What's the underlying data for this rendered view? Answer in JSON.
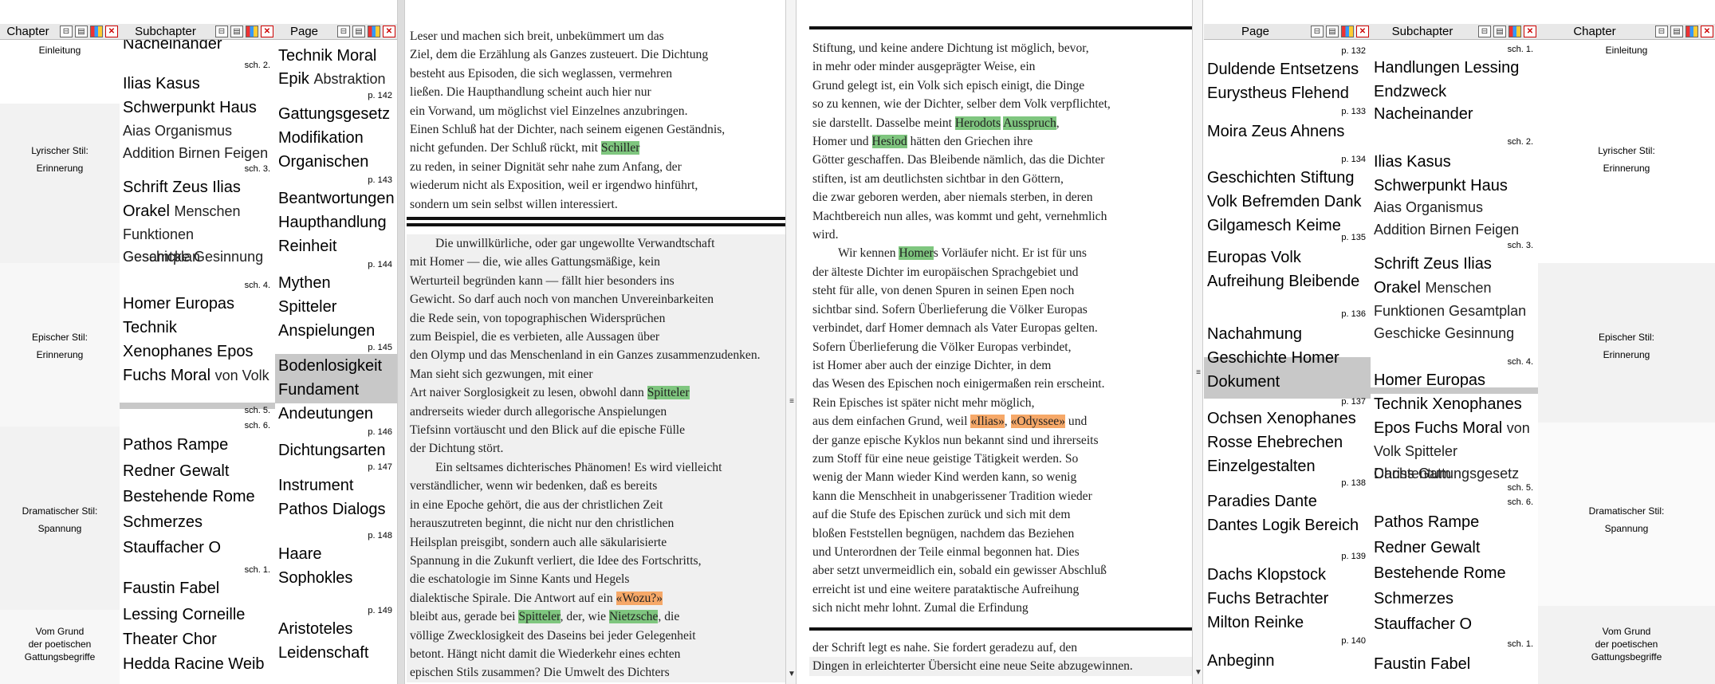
{
  "left": {
    "chapter": {
      "title": "Chapter",
      "items": [
        "Einleitung",
        "Lyrischer Stil:",
        "Erinnerung",
        "Epischer Stil:",
        "Erinnerung",
        "Dramatischer Stil:",
        "Spannung",
        "Vom Grund",
        "der poetischen",
        "Gattungsbegriffe"
      ]
    },
    "subchapter": {
      "title": "Subchapter",
      "lines": [
        "Nacheinander",
        "sch. 2.",
        "Ilias Kasus",
        "Schwerpunkt Haus",
        "Aias Organismus",
        "Addition Birnen Feigen",
        "sch. 3.",
        "Schrift Zeus Ilias",
        "Orakel",
        "Menschen",
        "Funktionen Gesamtplan",
        "Geschicke Gesinnung",
        "sch. 4.",
        "Homer Europas",
        "Technik",
        "Xenophanes Epos",
        "Fuchs Moral",
        "von Volk",
        "sch. 5.",
        "sch. 6.",
        "Pathos Rampe",
        "Redner Gewalt",
        "Bestehende Rome",
        "Schmerzes",
        "Stauffacher O",
        "sch. 1.",
        "Faustin Fabel",
        "Lessing Corneille",
        "Theater Chor",
        "Hedda Racine Weib"
      ]
    },
    "page": {
      "title": "Page",
      "lines": [
        "Technik Moral",
        "Epik",
        "Abstraktion",
        "p. 142",
        "Gattungsgesetz",
        "Modifikation",
        "Organischen",
        "p. 143",
        "Beantwortungen",
        "Haupthandlung",
        "Reinheit",
        "p. 144",
        "Mythen",
        "Spitteler",
        "Anspielungen",
        "p. 145",
        "Bodenlosigkeit",
        "Fundament",
        "Andeutungen",
        "p. 146",
        "Dichtungsarten",
        "p. 147",
        "Instrument",
        "Pathos Dialogs",
        "p. 148",
        "Haare",
        "Sophokles",
        "p. 149",
        "Aristoteles",
        "Leidenschaft"
      ]
    }
  },
  "text_left_top": [
    "Leser und machen sich breit, unbekümmert um das",
    "Ziel, dem die Erzählung als Ganzes zusteuert. Die Dichtung",
    "besteht aus Episoden, die sich weglassen, vermehren",
    "ließen. Die Haupthandlung scheint auch hier nur",
    "ein Vorwand, um möglichst viel Einzelnes anzubringen.",
    "Einen Schluß hat der Dichter, nach seinem eigenen Geständnis,",
    "nicht gefunden. Der Schluß rückt, mit ",
    "Schiller",
    "zu reden, in seiner Dignität sehr nahe zum Anfang, der",
    "wiederum nicht als Exposition, weil er irgendwo hinführt,",
    "sondern um sein selbst willen interessiert."
  ],
  "text_left_bottom": [
    "Die unwillkürliche, oder gar ungewollte Verwandtschaft",
    "mit Homer — die, wie alles Gattungsmäßige, kein",
    "Werturteil begründen kann — fällt hier besonders ins",
    "Gewicht. So darf auch noch von manchen Unvereinbarkeiten",
    "die Rede sein, von topographischen Widersprüchen",
    "zum Beispiel, die es verbieten, alle Aussagen über",
    "den Olymp und das Menschenland in ein Ganzes zusammenzudenken.",
    "Man sieht sich gezwungen, mit einer",
    "Art naiver Sorglosigkeit zu lesen, obwohl dann ",
    "Spitteler",
    "andrerseits wieder durch allegorische Anspielungen",
    "Tiefsinn vortäuscht und den Blick auf die epische Fülle",
    "der Dichtung stört.",
    "Ein seltsames dichterisches Phänomen! Es wird vielleicht",
    "verständlicher, wenn wir bedenken, daß es bereits",
    "in eine Epoche gehört, die aus der christlichen Zeit",
    "herauszutreten beginnt, die nicht nur den christlichen",
    "Heilsplan preisgibt, sondern auch alle säkularisierte",
    "Spannung in die Zukunft verliert, die Idee des Fortschritts,",
    "die eschatologie im Sinne Kants und Hegels",
    "dialektische Spirale. Die Antwort auf ein ",
    "«Wozu?»",
    "bleibt aus, gerade bei ",
    "Spitteler",
    ", der, wie ",
    "Nietzsche",
    ", die",
    "völlige Zwecklosigkeit des Daseins bei jeder Gelegenheit",
    "betont. Hängt nicht damit die Wiederkehr eines echten",
    "epischen Stils zusammen? Die Umwelt des Dichters"
  ],
  "text_right_top": [
    "Stiftung, und keine andere Dichtung ist möglich, bevor,",
    "in mehr oder minder ausgeprägter Weise, ein",
    "Grund gelegt ist, ein Volk sich episch einigt, die Dinge",
    "so zu kennen, wie der Dichter, selber dem Volk verpflichtet,",
    "sie darstellt. Dasselbe meint ",
    "Herodots",
    "Ausspruch",
    ",",
    "Homer und ",
    "Hesiod",
    " hätten den Griechen ihre",
    "Götter geschaffen. Das Bleibende nämlich, das die Dichter",
    "stiften, ist am deutlichsten sichtbar in den Göttern,",
    "die zwar geboren werden, aber niemals sterben, in deren",
    "Machtbereich nun alles, was kommt und geht, vernehmlich",
    "wird.",
    "Wir kennen ",
    "Homer",
    "s Vorläufer nicht. Er ist für uns",
    "der älteste Dichter im europäischen Sprachgebiet und",
    "steht für alle, von denen Spuren in seinen Epen noch",
    "sichtbar sind. Sofern Überlieferung die Völker Europas",
    "verbindet, darf Homer demnach als Vater Europas gelten.",
    "Sofern Überlieferung die Völker Europas verbindet,",
    "ist Homer aber auch der einzige Dichter, in dem",
    "das Wesen des Epischen noch einigermaßen rein erscheint.",
    "Rein Episches ist später nicht mehr möglich,",
    "aus dem einfachen Grund, weil ",
    "«Ilias»",
    "«Odyssee»",
    " und",
    "der ganze epische Kyklos nun bekannt sind und ihrerseits",
    "zum Stoff für eine neue geistige Tätigkeit werden. So",
    "wenig der Mann wieder Kind werden kann, so wenig",
    "kann die Menschheit in unabgerissener Tradition wieder",
    "auf die Stufe des Epischen zurück und sich mit dem",
    "bloßen Feststellen begnügen, nachdem das Beziehen",
    "und Unterordnen der Teile einmal begonnen hat. Dies",
    "aber setzt unvermeidlich ein, sobald ein gewisser Abschluß",
    "erreicht ist und eine weitere parataktische Aufreihung",
    "sich nicht mehr lohnt. Zumal die Erfindung"
  ],
  "text_right_bottom": [
    "der Schrift legt es nahe. Sie fordert geradezu auf, den",
    "Dingen in erleichterter Übersicht eine neue Seite abzugewinnen."
  ],
  "right": {
    "page": {
      "title": "Page",
      "lines": [
        "p. 132",
        "Duldende Entsetzens",
        "Eurystheus Flehend",
        "p. 133",
        "Moira Zeus Ahnens",
        "p. 134",
        "Geschichten Stiftung",
        "Volk Befremden Dank",
        "Gilgamesch Keime",
        "p. 135",
        "Europas Volk",
        "Aufreihung Bleibende",
        "p. 136",
        "Nachahmung",
        "Geschichte Homer",
        "Dokument",
        "p. 137",
        "Ochsen Xenophanes",
        "Rosse Ehebrechen",
        "Einzelgestalten",
        "p. 138",
        "Paradies Dante",
        "Dantes Logik Bereich",
        "p. 139",
        "Dachs Klopstock",
        "Fuchs Betrachter",
        "Milton Reinke",
        "p. 140",
        "Anbeginn"
      ]
    },
    "subchapter": {
      "title": "Subchapter",
      "lines": [
        "sch. 1.",
        "Handlungen Lessing",
        "Endzweck",
        "Nacheinander",
        "sch. 2.",
        "Ilias Kasus",
        "Schwerpunkt Haus",
        "Aias Organismus",
        "Addition Birnen Feigen",
        "sch. 3.",
        "Schrift Zeus Ilias",
        "Orakel",
        "Menschen",
        "Funktionen Gesamtplan",
        "Geschicke Gesinnung",
        "sch. 4.",
        "Homer Europas",
        "Technik Xenophanes",
        "Epos Fuchs Moral",
        "von",
        "Volk Spitteler Christentum",
        "Dachs Gattungsgesetz",
        "sch. 5.",
        "sch. 6.",
        "Pathos Rampe",
        "Redner Gewalt",
        "Bestehende Rome",
        "Schmerzes",
        "Stauffacher O",
        "sch. 1.",
        "Faustin Fabel"
      ]
    },
    "chapter": {
      "title": "Chapter",
      "items": [
        "Einleitung",
        "Lyrischer Stil:",
        "Erinnerung",
        "Epischer Stil:",
        "Erinnerung",
        "Dramatischer Stil:",
        "Spannung",
        "Vom Grund",
        "der poetischen",
        "Gattungsbegriffe"
      ]
    }
  },
  "colors": {
    "green": "#7fc67f",
    "orange": "#f6a868",
    "header": "#e8e8e8"
  }
}
